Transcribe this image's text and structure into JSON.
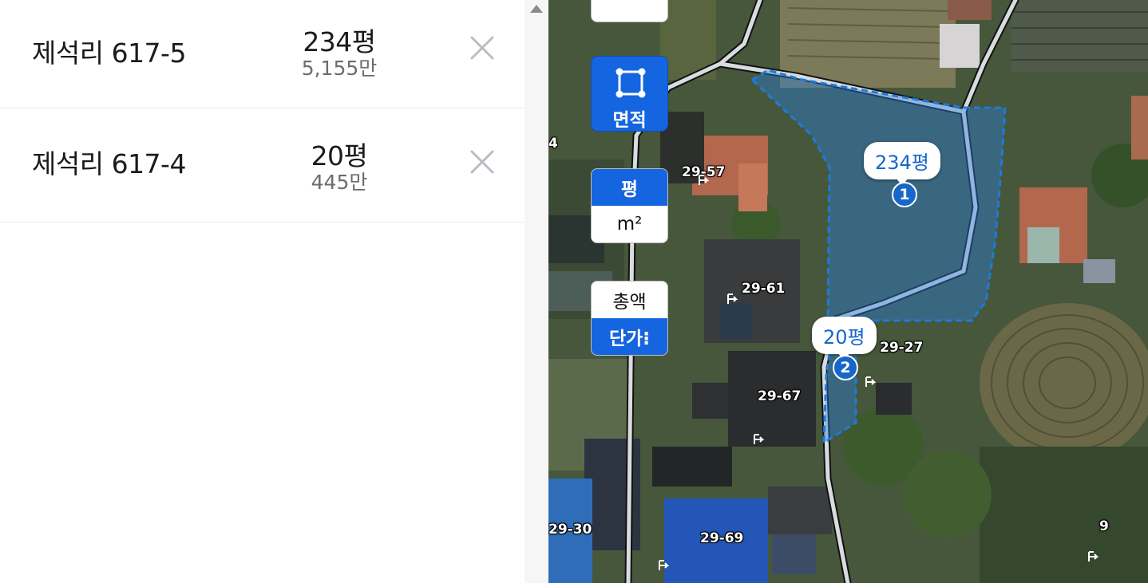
{
  "parcels": [
    {
      "name": "제석리 617-5",
      "size": "234평",
      "price": "5,155만"
    },
    {
      "name": "제석리 617-4",
      "size": "20평",
      "price": "445만"
    }
  ],
  "map": {
    "area_button_label": "면적",
    "unit_toggle": {
      "selected": "평",
      "other": "m²"
    },
    "price_toggle": {
      "unselected": "총액",
      "selected": "단가⁝"
    },
    "callouts": [
      {
        "marker": "1",
        "size": "234평"
      },
      {
        "marker": "2",
        "size": "20평"
      }
    ],
    "lot_labels": [
      "29-57",
      "29-61",
      "29-27",
      "29-67",
      "29-30",
      "29-69",
      "9",
      "4"
    ],
    "accent_color": "#1565e0",
    "selection_color": "#1e7bd8"
  },
  "icons": {
    "remove": "close-icon",
    "scroll": "scroll-up-arrow-icon",
    "area_tool": "polygon-select-icon",
    "lot": "lot-pin-icon"
  }
}
